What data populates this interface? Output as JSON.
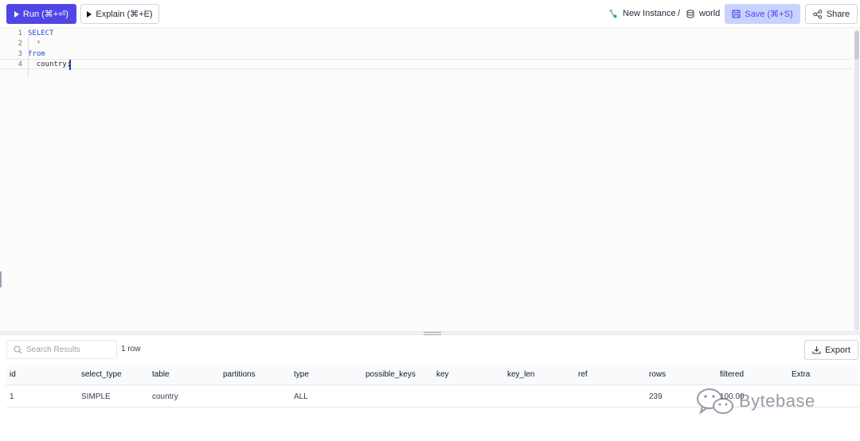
{
  "toolbar": {
    "run_label": "Run (⌘+⏎)",
    "explain_label": "Explain (⌘+E)",
    "instance": "New Instance",
    "separator": "/",
    "database": "world",
    "save_label": "Save (⌘+S)",
    "share_label": "Share"
  },
  "editor": {
    "lines": [
      {
        "num": "1",
        "text": "SELECT"
      },
      {
        "num": "2",
        "text": "  *"
      },
      {
        "num": "3",
        "text": "from"
      },
      {
        "num": "4",
        "text": "  country;"
      }
    ]
  },
  "results": {
    "search_placeholder": "Search Results",
    "row_count": "1 row",
    "export_label": "Export",
    "columns": [
      "id",
      "select_type",
      "table",
      "partitions",
      "type",
      "possible_keys",
      "key",
      "key_len",
      "ref",
      "rows",
      "filtered",
      "Extra"
    ],
    "rows": [
      [
        "1",
        "SIMPLE",
        "country",
        "",
        "ALL",
        "",
        "",
        "",
        "",
        "239",
        "100.00",
        ""
      ]
    ]
  },
  "watermark": {
    "text": "Bytebase"
  },
  "colors": {
    "accent": "#4f46e5",
    "save_bg": "#c7d2fe",
    "keyword": "#1d4ed8",
    "env_dot": "#10b981"
  }
}
